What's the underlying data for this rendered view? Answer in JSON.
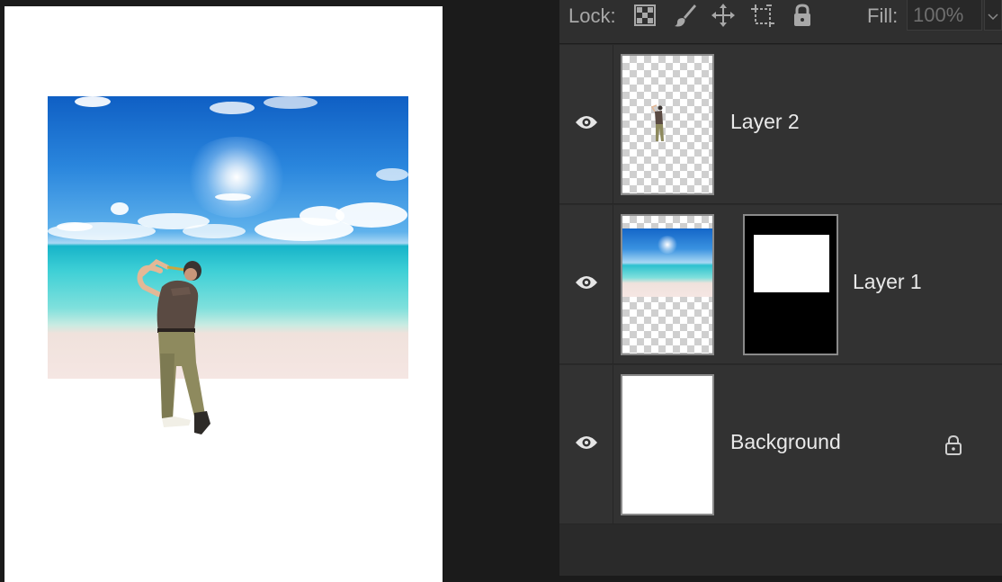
{
  "lock_bar": {
    "lock_label": "Lock:",
    "fill_label": "Fill:",
    "fill_value": "100%",
    "icons": [
      "lock-transparent-pixels-icon",
      "lock-image-pixels-icon",
      "lock-position-icon",
      "lock-artboard-icon",
      "lock-all-icon"
    ]
  },
  "layers": [
    {
      "name": "Layer 2",
      "visible": true,
      "thumbnail": "golfer-on-transparent"
    },
    {
      "name": "Layer 1",
      "visible": true,
      "thumbnail": "beach-on-transparent",
      "mask": true
    },
    {
      "name": "Background",
      "visible": true,
      "thumbnail": "white",
      "locked": true
    }
  ],
  "colors": {
    "panel_bg": "#2a2a2a",
    "row_bg": "#323232",
    "canvas_bg": "#1b1b1b",
    "text": "#e9e9e9"
  }
}
